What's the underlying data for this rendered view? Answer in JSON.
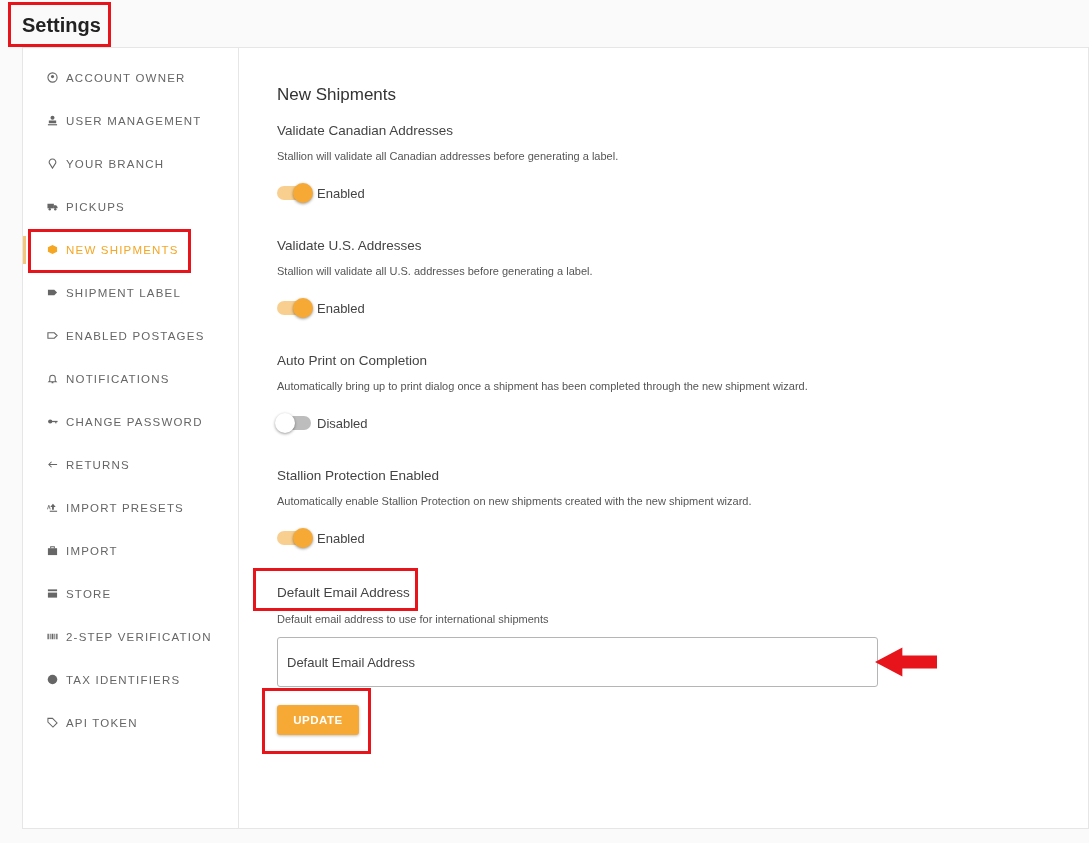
{
  "page": {
    "title": "Settings",
    "highlighted": true
  },
  "sidebar": {
    "items": [
      {
        "label": "ACCOUNT OWNER",
        "selected": false,
        "highlighted": false
      },
      {
        "label": "USER MANAGEMENT",
        "selected": false,
        "highlighted": false
      },
      {
        "label": "YOUR BRANCH",
        "selected": false,
        "highlighted": false
      },
      {
        "label": "PICKUPS",
        "selected": false,
        "highlighted": false
      },
      {
        "label": "NEW SHIPMENTS",
        "selected": true,
        "highlighted": true
      },
      {
        "label": "SHIPMENT LABEL",
        "selected": false,
        "highlighted": false
      },
      {
        "label": "ENABLED POSTAGES",
        "selected": false,
        "highlighted": false
      },
      {
        "label": "NOTIFICATIONS",
        "selected": false,
        "highlighted": false
      },
      {
        "label": "CHANGE PASSWORD",
        "selected": false,
        "highlighted": false
      },
      {
        "label": "RETURNS",
        "selected": false,
        "highlighted": false
      },
      {
        "label": "IMPORT PRESETS",
        "selected": false,
        "highlighted": false
      },
      {
        "label": "IMPORT",
        "selected": false,
        "highlighted": false
      },
      {
        "label": "STORE",
        "selected": false,
        "highlighted": false
      },
      {
        "label": "2-STEP VERIFICATION",
        "selected": false,
        "highlighted": false
      },
      {
        "label": "TAX IDENTIFIERS",
        "selected": false,
        "highlighted": false
      },
      {
        "label": "API TOKEN",
        "selected": false,
        "highlighted": false
      }
    ]
  },
  "content": {
    "heading": "New Shipments",
    "settings": [
      {
        "kind": "toggle",
        "title": "Validate Canadian Addresses",
        "description": "Stallion will validate all Canadian addresses before generating a label.",
        "on": true,
        "state_label": "Enabled"
      },
      {
        "kind": "toggle",
        "title": "Validate U.S. Addresses",
        "description": "Stallion will validate all U.S. addresses before generating a label.",
        "on": true,
        "state_label": "Enabled"
      },
      {
        "kind": "toggle",
        "title": "Auto Print on Completion",
        "description": "Automatically bring up to print dialog once a shipment has been completed through the new shipment wizard.",
        "on": false,
        "state_label": "Disabled"
      },
      {
        "kind": "toggle",
        "title": "Stallion Protection Enabled",
        "description": "Automatically enable Stallion Protection on new shipments created with the new shipment wizard.",
        "on": true,
        "state_label": "Enabled"
      },
      {
        "kind": "field",
        "title": "Default Email Address",
        "description": "Default email address to use for international shipments",
        "placeholder": "Default Email Address",
        "highlighted": true,
        "pointer_arrow": true
      }
    ],
    "update_button": {
      "label": "UPDATE",
      "highlighted": true
    }
  }
}
